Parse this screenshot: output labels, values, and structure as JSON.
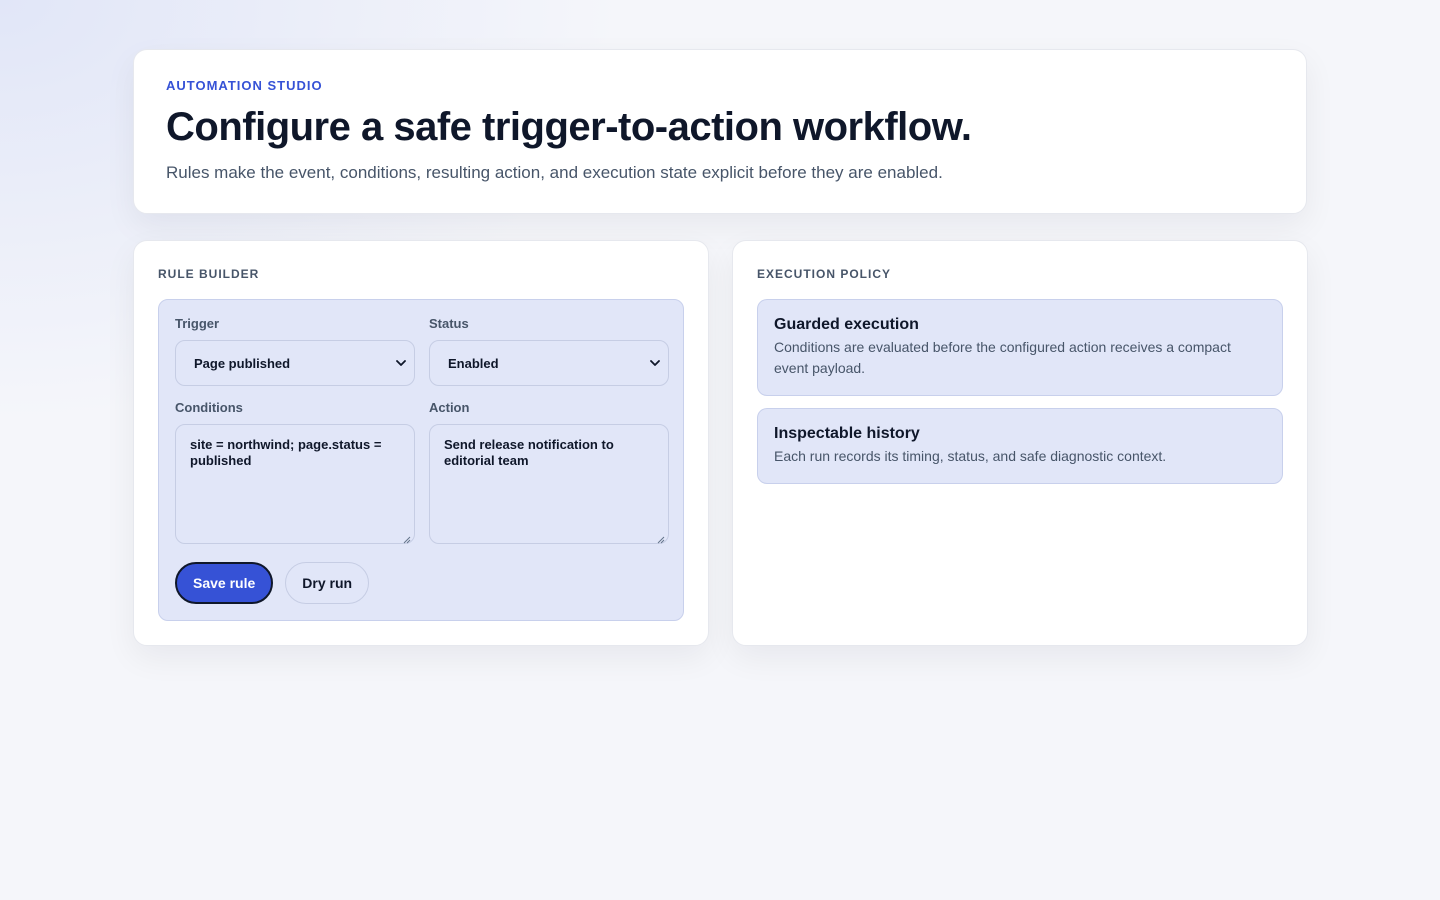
{
  "hero": {
    "eyebrow": "AUTOMATION STUDIO",
    "title": "Configure a safe trigger-to-action workflow.",
    "subtitle": "Rules make the event, conditions, resulting action, and execution state explicit before they are enabled."
  },
  "rule_builder": {
    "heading": "RULE BUILDER",
    "trigger": {
      "label": "Trigger",
      "value": "Page published"
    },
    "status": {
      "label": "Status",
      "value": "Enabled"
    },
    "conditions": {
      "label": "Conditions",
      "value": "site = northwind; page.status = published"
    },
    "action": {
      "label": "Action",
      "value": "Send release notification to editorial team"
    },
    "save_label": "Save rule",
    "dry_run_label": "Dry run"
  },
  "execution_policy": {
    "heading": "EXECUTION POLICY",
    "cards": [
      {
        "title": "Guarded execution",
        "text": "Conditions are evaluated before the configured action receives a compact event payload."
      },
      {
        "title": "Inspectable history",
        "text": "Each run records its timing, status, and safe diagnostic context."
      }
    ]
  },
  "colors": {
    "accent": "#3652d6",
    "panel_fill": "#e1e6f8",
    "heading": "#0f172a",
    "muted": "#475569"
  }
}
